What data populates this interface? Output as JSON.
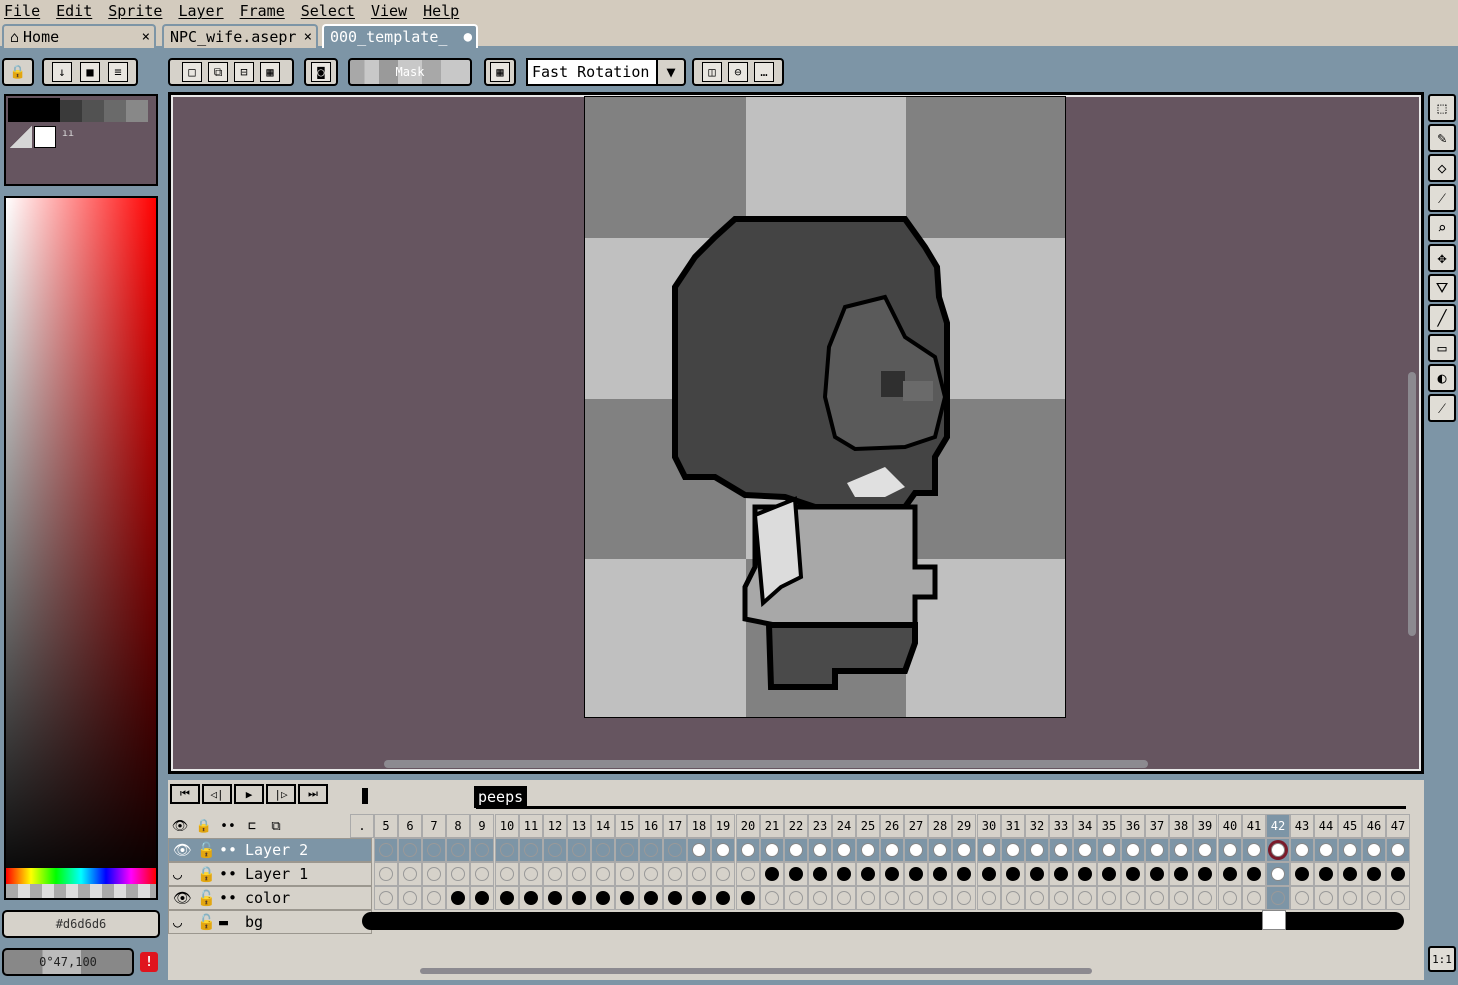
{
  "menu": [
    "File",
    "Edit",
    "Sprite",
    "Layer",
    "Frame",
    "Select",
    "View",
    "Help"
  ],
  "tabs": [
    {
      "label": "Home",
      "icon": "home-icon",
      "close": "×"
    },
    {
      "label": "NPC_wife.asepr",
      "close": "×"
    },
    {
      "label": "000_template_",
      "close": "●"
    }
  ],
  "toolbar": {
    "mask_label": "Mask",
    "rotation_algorithm": "Fast Rotation"
  },
  "color": {
    "hex": "#d6d6d6",
    "alpha": "0°47,100",
    "warning": "!"
  },
  "timeline": {
    "tag_name": "peeps",
    "frame_numbers": [
      5,
      6,
      7,
      8,
      9,
      10,
      11,
      12,
      13,
      14,
      15,
      16,
      17,
      18,
      19,
      20,
      21,
      22,
      23,
      24,
      25,
      26,
      27,
      28,
      29,
      30,
      31,
      32,
      33,
      34,
      35,
      36,
      37,
      38,
      39,
      40,
      41,
      42,
      43,
      44,
      45,
      46,
      47
    ],
    "current_frame": 42,
    "first_column_label": ".",
    "layers": [
      {
        "name": "Layer 2",
        "visible": true,
        "locked": false
      },
      {
        "name": "Layer 1",
        "visible": false,
        "locked": true
      },
      {
        "name": "color",
        "visible": true,
        "locked": false
      },
      {
        "name": "bg",
        "visible": false,
        "locked": false
      }
    ]
  },
  "zoom_label": "1:1",
  "colors": {
    "bg": "#7d95a6",
    "panel": "#d6d2ca",
    "canvas_bg": "#665560",
    "menu": "#d3cbbe",
    "current_frame_accent": "#7a1a2a"
  }
}
